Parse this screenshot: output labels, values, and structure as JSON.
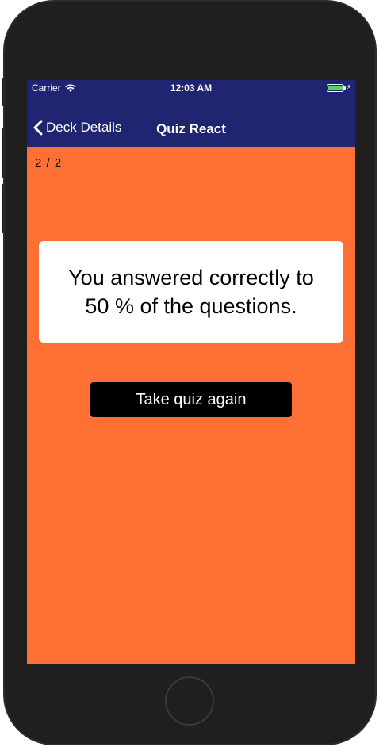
{
  "status_bar": {
    "carrier": "Carrier",
    "time": "12:03 AM",
    "wifi_icon": "wifi-icon",
    "battery_icon": "battery-icon",
    "charging_icon": "bolt-icon",
    "battery_color": "#4cd964"
  },
  "nav": {
    "back_label": "Deck Details",
    "back_icon": "chevron-left-icon",
    "title": "Quiz React",
    "background": "#1f2571"
  },
  "quiz": {
    "counter": "2 / 2",
    "result_message": "You answered correctly to 50 % of the questions.",
    "retake_label": "Take quiz again",
    "background": "#ff7034"
  },
  "device": {
    "home_button_icon": "home-button"
  }
}
